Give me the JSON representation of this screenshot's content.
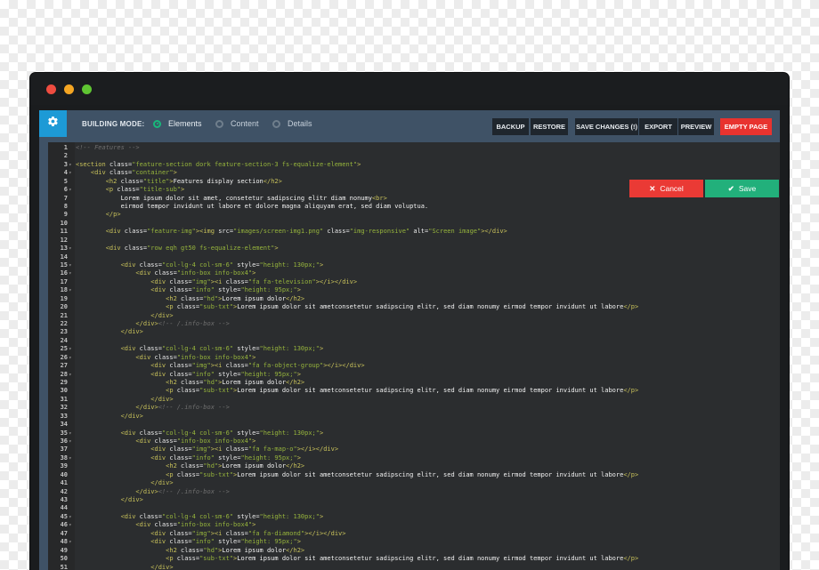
{
  "toolbar": {
    "building_mode_label": "BUILDING MODE:",
    "modes": [
      {
        "label": "Elements",
        "selected": true
      },
      {
        "label": "Content",
        "selected": false
      },
      {
        "label": "Details",
        "selected": false
      }
    ],
    "buttons": {
      "backup": "BACKUP",
      "restore": "RESTORE",
      "save_changes": "SAVE CHANGES (!)",
      "export": "EXPORT",
      "preview": "PREVIEW",
      "empty_page": "EMPTY PAGE"
    },
    "gear_icon": "gear-icon"
  },
  "actions": {
    "cancel_label": "Cancel",
    "cancel_icon": "close-icon",
    "save_label": "Save",
    "save_icon": "check-icon"
  },
  "colors": {
    "accent_blue": "#1d9ad6",
    "cancel_red": "#ea3a35",
    "save_green": "#22b07b",
    "empty_page_red": "#e8332f",
    "toolbar_bg": "#3f5266"
  },
  "editor": {
    "lines": [
      {
        "n": "1",
        "fold": false,
        "segs": [
          [
            "cm",
            "<!-- Features -->"
          ]
        ]
      },
      {
        "n": "2",
        "fold": false,
        "segs": [
          [
            "cm",
            ""
          ]
        ]
      },
      {
        "n": "3",
        "fold": true,
        "segs": [
          [
            "tg",
            "<section "
          ],
          [
            "at",
            "class="
          ],
          [
            "vl",
            "\"feature-section dork feature-section-3 fs-equalize-element\""
          ],
          [
            "tg",
            ">"
          ]
        ]
      },
      {
        "n": "4",
        "fold": true,
        "segs": [
          [
            "tg",
            "    <div "
          ],
          [
            "at",
            "class="
          ],
          [
            "vl",
            "\"container\""
          ],
          [
            "tg",
            ">"
          ]
        ]
      },
      {
        "n": "5",
        "fold": false,
        "segs": [
          [
            "tg",
            "        <h2 "
          ],
          [
            "at",
            "class="
          ],
          [
            "vl",
            "\"title\""
          ],
          [
            "tg",
            ">"
          ],
          [
            "tx",
            "Features display section"
          ],
          [
            "tg",
            "</h2>"
          ]
        ]
      },
      {
        "n": "6",
        "fold": true,
        "segs": [
          [
            "tg",
            "        <p "
          ],
          [
            "at",
            "class="
          ],
          [
            "vl",
            "\"title-sub\""
          ],
          [
            "tg",
            ">"
          ]
        ]
      },
      {
        "n": "7",
        "fold": false,
        "segs": [
          [
            "tx",
            "            Lorem ipsum dolor sit amet, consetetur sadipscing elitr diam nonumy"
          ],
          [
            "tg",
            "<br>"
          ]
        ]
      },
      {
        "n": "8",
        "fold": false,
        "segs": [
          [
            "tx",
            "            eirmod tempor invidunt ut labore et dolore magna aliquyam erat, sed diam voluptua."
          ]
        ]
      },
      {
        "n": "9",
        "fold": false,
        "segs": [
          [
            "tg",
            "        </p>"
          ]
        ]
      },
      {
        "n": "10",
        "fold": false,
        "segs": [
          [
            "tx",
            ""
          ]
        ]
      },
      {
        "n": "11",
        "fold": false,
        "segs": [
          [
            "tg",
            "        <div "
          ],
          [
            "at",
            "class="
          ],
          [
            "vl",
            "\"feature-img\""
          ],
          [
            "tg",
            "><img "
          ],
          [
            "at",
            "src="
          ],
          [
            "vl",
            "\"images/screen-img1.png\""
          ],
          [
            "at",
            " class="
          ],
          [
            "vl",
            "\"img-responsive\""
          ],
          [
            "at",
            " alt="
          ],
          [
            "vl",
            "\"Screen image\""
          ],
          [
            "tg",
            "></div>"
          ]
        ]
      },
      {
        "n": "12",
        "fold": false,
        "segs": [
          [
            "tx",
            ""
          ]
        ]
      },
      {
        "n": "13",
        "fold": true,
        "segs": [
          [
            "tg",
            "        <div "
          ],
          [
            "at",
            "class="
          ],
          [
            "vl",
            "\"row eqh gt50 fs-equalize-element\""
          ],
          [
            "tg",
            ">"
          ]
        ]
      },
      {
        "n": "14",
        "fold": false,
        "segs": [
          [
            "tx",
            ""
          ]
        ]
      },
      {
        "n": "15",
        "fold": true,
        "segs": [
          [
            "tg",
            "            <div "
          ],
          [
            "at",
            "class="
          ],
          [
            "vl",
            "\"col-lg-4 col-sm-6\""
          ],
          [
            "at",
            " style="
          ],
          [
            "vl",
            "\"height: 130px;\""
          ],
          [
            "tg",
            ">"
          ]
        ]
      },
      {
        "n": "16",
        "fold": true,
        "segs": [
          [
            "tg",
            "                <div "
          ],
          [
            "at",
            "class="
          ],
          [
            "vl",
            "\"info-box info-box4\""
          ],
          [
            "tg",
            ">"
          ]
        ]
      },
      {
        "n": "17",
        "fold": false,
        "segs": [
          [
            "tg",
            "                    <div "
          ],
          [
            "at",
            "class="
          ],
          [
            "vl",
            "\"img\""
          ],
          [
            "tg",
            "><i "
          ],
          [
            "at",
            "class="
          ],
          [
            "vl",
            "\"fa fa-television\""
          ],
          [
            "tg",
            "></i></div>"
          ]
        ]
      },
      {
        "n": "18",
        "fold": true,
        "segs": [
          [
            "tg",
            "                    <div "
          ],
          [
            "at",
            "class="
          ],
          [
            "vl",
            "\"info\""
          ],
          [
            "at",
            " style="
          ],
          [
            "vl",
            "\"height: 95px;\""
          ],
          [
            "tg",
            ">"
          ]
        ]
      },
      {
        "n": "19",
        "fold": false,
        "segs": [
          [
            "tg",
            "                        <h2 "
          ],
          [
            "at",
            "class="
          ],
          [
            "vl",
            "\"hd\""
          ],
          [
            "tg",
            ">"
          ],
          [
            "tx",
            "Lorem ipsum dolor"
          ],
          [
            "tg",
            "</h2>"
          ]
        ]
      },
      {
        "n": "20",
        "fold": false,
        "segs": [
          [
            "tg",
            "                        <p "
          ],
          [
            "at",
            "class="
          ],
          [
            "vl",
            "\"sub-txt\""
          ],
          [
            "tg",
            ">"
          ],
          [
            "tx",
            "Lorem ipsum dolor sit ametconsetetur sadipscing elitr, sed diam nonumy eirmod tempor invidunt ut labore"
          ],
          [
            "tg",
            "</p>"
          ]
        ]
      },
      {
        "n": "21",
        "fold": false,
        "segs": [
          [
            "tg",
            "                    </div>"
          ]
        ]
      },
      {
        "n": "22",
        "fold": false,
        "segs": [
          [
            "tg",
            "                </div>"
          ],
          [
            "cm",
            "<!-- /.info-box -->"
          ]
        ]
      },
      {
        "n": "23",
        "fold": false,
        "segs": [
          [
            "tg",
            "            </div>"
          ]
        ]
      },
      {
        "n": "24",
        "fold": false,
        "segs": [
          [
            "tx",
            ""
          ]
        ]
      },
      {
        "n": "25",
        "fold": true,
        "segs": [
          [
            "tg",
            "            <div "
          ],
          [
            "at",
            "class="
          ],
          [
            "vl",
            "\"col-lg-4 col-sm-6\""
          ],
          [
            "at",
            " style="
          ],
          [
            "vl",
            "\"height: 130px;\""
          ],
          [
            "tg",
            ">"
          ]
        ]
      },
      {
        "n": "26",
        "fold": true,
        "segs": [
          [
            "tg",
            "                <div "
          ],
          [
            "at",
            "class="
          ],
          [
            "vl",
            "\"info-box info-box4\""
          ],
          [
            "tg",
            ">"
          ]
        ]
      },
      {
        "n": "27",
        "fold": false,
        "segs": [
          [
            "tg",
            "                    <div "
          ],
          [
            "at",
            "class="
          ],
          [
            "vl",
            "\"img\""
          ],
          [
            "tg",
            "><i "
          ],
          [
            "at",
            "class="
          ],
          [
            "vl",
            "\"fa fa-object-group\""
          ],
          [
            "tg",
            "></i></div>"
          ]
        ]
      },
      {
        "n": "28",
        "fold": true,
        "segs": [
          [
            "tg",
            "                    <div "
          ],
          [
            "at",
            "class="
          ],
          [
            "vl",
            "\"info\""
          ],
          [
            "at",
            " style="
          ],
          [
            "vl",
            "\"height: 95px;\""
          ],
          [
            "tg",
            ">"
          ]
        ]
      },
      {
        "n": "29",
        "fold": false,
        "segs": [
          [
            "tg",
            "                        <h2 "
          ],
          [
            "at",
            "class="
          ],
          [
            "vl",
            "\"hd\""
          ],
          [
            "tg",
            ">"
          ],
          [
            "tx",
            "Lorem ipsum dolor"
          ],
          [
            "tg",
            "</h2>"
          ]
        ]
      },
      {
        "n": "30",
        "fold": false,
        "segs": [
          [
            "tg",
            "                        <p "
          ],
          [
            "at",
            "class="
          ],
          [
            "vl",
            "\"sub-txt\""
          ],
          [
            "tg",
            ">"
          ],
          [
            "tx",
            "Lorem ipsum dolor sit ametconsetetur sadipscing elitr, sed diam nonumy eirmod tempor invidunt ut labore"
          ],
          [
            "tg",
            "</p>"
          ]
        ]
      },
      {
        "n": "31",
        "fold": false,
        "segs": [
          [
            "tg",
            "                    </div>"
          ]
        ]
      },
      {
        "n": "32",
        "fold": false,
        "segs": [
          [
            "tg",
            "                </div>"
          ],
          [
            "cm",
            "<!-- /.info-box -->"
          ]
        ]
      },
      {
        "n": "33",
        "fold": false,
        "segs": [
          [
            "tg",
            "            </div>"
          ]
        ]
      },
      {
        "n": "34",
        "fold": false,
        "segs": [
          [
            "tx",
            ""
          ]
        ]
      },
      {
        "n": "35",
        "fold": true,
        "segs": [
          [
            "tg",
            "            <div "
          ],
          [
            "at",
            "class="
          ],
          [
            "vl",
            "\"col-lg-4 col-sm-6\""
          ],
          [
            "at",
            " style="
          ],
          [
            "vl",
            "\"height: 130px;\""
          ],
          [
            "tg",
            ">"
          ]
        ]
      },
      {
        "n": "36",
        "fold": true,
        "segs": [
          [
            "tg",
            "                <div "
          ],
          [
            "at",
            "class="
          ],
          [
            "vl",
            "\"info-box info-box4\""
          ],
          [
            "tg",
            ">"
          ]
        ]
      },
      {
        "n": "37",
        "fold": false,
        "segs": [
          [
            "tg",
            "                    <div "
          ],
          [
            "at",
            "class="
          ],
          [
            "vl",
            "\"img\""
          ],
          [
            "tg",
            "><i "
          ],
          [
            "at",
            "class="
          ],
          [
            "vl",
            "\"fa fa-map-o\""
          ],
          [
            "tg",
            "></i></div>"
          ]
        ]
      },
      {
        "n": "38",
        "fold": true,
        "segs": [
          [
            "tg",
            "                    <div "
          ],
          [
            "at",
            "class="
          ],
          [
            "vl",
            "\"info\""
          ],
          [
            "at",
            " style="
          ],
          [
            "vl",
            "\"height: 95px;\""
          ],
          [
            "tg",
            ">"
          ]
        ]
      },
      {
        "n": "39",
        "fold": false,
        "segs": [
          [
            "tg",
            "                        <h2 "
          ],
          [
            "at",
            "class="
          ],
          [
            "vl",
            "\"hd\""
          ],
          [
            "tg",
            ">"
          ],
          [
            "tx",
            "Lorem ipsum dolor"
          ],
          [
            "tg",
            "</h2>"
          ]
        ]
      },
      {
        "n": "40",
        "fold": false,
        "segs": [
          [
            "tg",
            "                        <p "
          ],
          [
            "at",
            "class="
          ],
          [
            "vl",
            "\"sub-txt\""
          ],
          [
            "tg",
            ">"
          ],
          [
            "tx",
            "Lorem ipsum dolor sit ametconsetetur sadipscing elitr, sed diam nonumy eirmod tempor invidunt ut labore"
          ],
          [
            "tg",
            "</p>"
          ]
        ]
      },
      {
        "n": "41",
        "fold": false,
        "segs": [
          [
            "tg",
            "                    </div>"
          ]
        ]
      },
      {
        "n": "42",
        "fold": false,
        "segs": [
          [
            "tg",
            "                </div>"
          ],
          [
            "cm",
            "<!-- /.info-box -->"
          ]
        ]
      },
      {
        "n": "43",
        "fold": false,
        "segs": [
          [
            "tg",
            "            </div>"
          ]
        ]
      },
      {
        "n": "44",
        "fold": false,
        "segs": [
          [
            "tx",
            ""
          ]
        ]
      },
      {
        "n": "45",
        "fold": true,
        "segs": [
          [
            "tg",
            "            <div "
          ],
          [
            "at",
            "class="
          ],
          [
            "vl",
            "\"col-lg-4 col-sm-6\""
          ],
          [
            "at",
            " style="
          ],
          [
            "vl",
            "\"height: 130px;\""
          ],
          [
            "tg",
            ">"
          ]
        ]
      },
      {
        "n": "46",
        "fold": true,
        "segs": [
          [
            "tg",
            "                <div "
          ],
          [
            "at",
            "class="
          ],
          [
            "vl",
            "\"info-box info-box4\""
          ],
          [
            "tg",
            ">"
          ]
        ]
      },
      {
        "n": "47",
        "fold": false,
        "segs": [
          [
            "tg",
            "                    <div "
          ],
          [
            "at",
            "class="
          ],
          [
            "vl",
            "\"img\""
          ],
          [
            "tg",
            "><i "
          ],
          [
            "at",
            "class="
          ],
          [
            "vl",
            "\"fa fa-diamond\""
          ],
          [
            "tg",
            "></i></div>"
          ]
        ]
      },
      {
        "n": "48",
        "fold": true,
        "segs": [
          [
            "tg",
            "                    <div "
          ],
          [
            "at",
            "class="
          ],
          [
            "vl",
            "\"info\""
          ],
          [
            "at",
            " style="
          ],
          [
            "vl",
            "\"height: 95px;\""
          ],
          [
            "tg",
            ">"
          ]
        ]
      },
      {
        "n": "49",
        "fold": false,
        "segs": [
          [
            "tg",
            "                        <h2 "
          ],
          [
            "at",
            "class="
          ],
          [
            "vl",
            "\"hd\""
          ],
          [
            "tg",
            ">"
          ],
          [
            "tx",
            "Lorem ipsum dolor"
          ],
          [
            "tg",
            "</h2>"
          ]
        ]
      },
      {
        "n": "50",
        "fold": false,
        "segs": [
          [
            "tg",
            "                        <p "
          ],
          [
            "at",
            "class="
          ],
          [
            "vl",
            "\"sub-txt\""
          ],
          [
            "tg",
            ">"
          ],
          [
            "tx",
            "Lorem ipsum dolor sit ametconsetetur sadipscing elitr, sed diam nonumy eirmod tempor invidunt ut labore"
          ],
          [
            "tg",
            "</p>"
          ]
        ]
      },
      {
        "n": "51",
        "fold": false,
        "segs": [
          [
            "tg",
            "                    </div>"
          ]
        ]
      }
    ]
  }
}
